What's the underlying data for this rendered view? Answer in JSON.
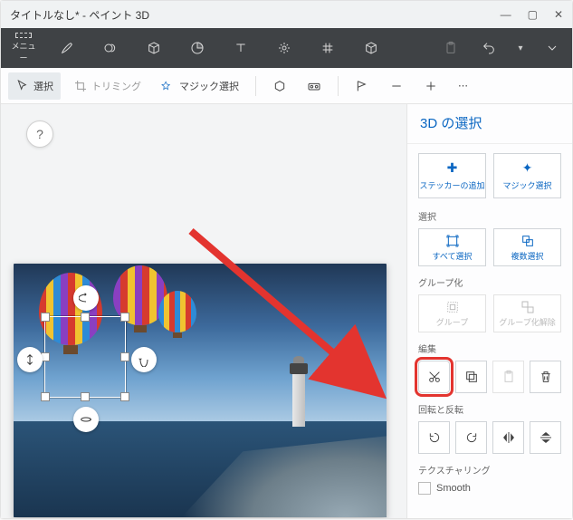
{
  "title": "タイトルなし* - ペイント 3D",
  "menu_label": "メニュー",
  "secondbar": {
    "select": "選択",
    "trim": "トリミング",
    "magic": "マジック選択"
  },
  "help": "?",
  "sidebar": {
    "title": "3D の選択",
    "add_sticker": "ステッカーの追加",
    "magic_select": "マジック選択",
    "sec_select": "選択",
    "select_all": "すべて選択",
    "multi_select": "複数選択",
    "sec_group": "グループ化",
    "group": "グループ",
    "ungroup": "グループ化解除",
    "sec_edit": "編集",
    "sec_rotate": "回転と反転",
    "sec_texture": "テクスチャリング",
    "smooth": "Smooth"
  }
}
